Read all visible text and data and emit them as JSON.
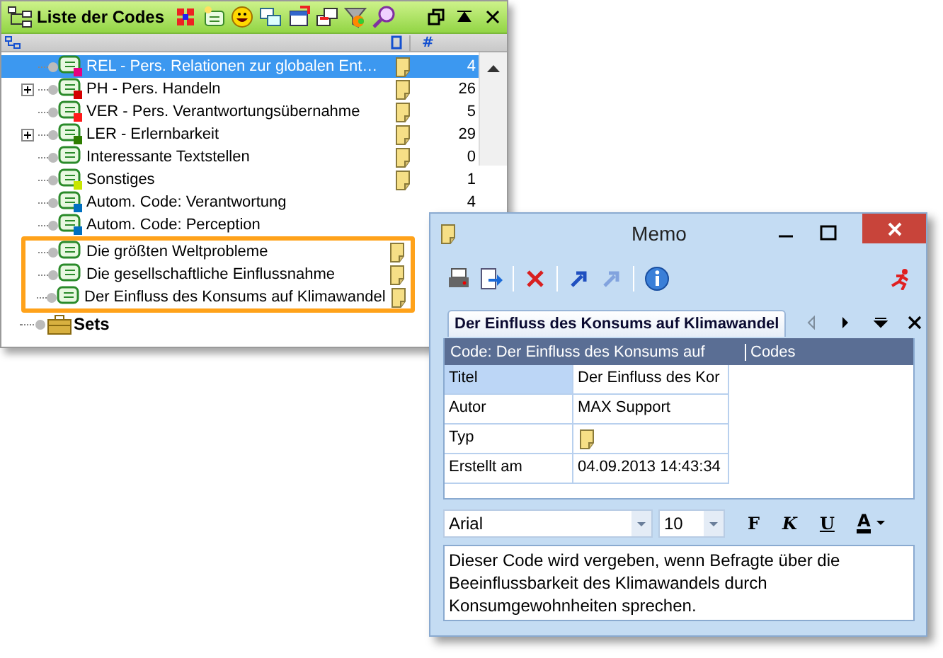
{
  "codes_window": {
    "title": "Liste der Codes",
    "count_header": "#"
  },
  "codes": [
    {
      "label": "REL - Pers. Relationen zur globalen Ent…",
      "selected": true,
      "collapsed": false,
      "color": "#e6007e",
      "memo": true,
      "count": "4"
    },
    {
      "label": "PH - Pers. Handeln",
      "selected": false,
      "collapsed": true,
      "color": "#d40000",
      "memo": true,
      "count": "26"
    },
    {
      "label": "VER - Pers. Verantwortungsübernahme",
      "selected": false,
      "collapsed": false,
      "color": "#ff1a1a",
      "memo": true,
      "count": "5"
    },
    {
      "label": "LER - Erlernbarkeit",
      "selected": false,
      "collapsed": true,
      "color": "#2e7d00",
      "memo": true,
      "count": "29"
    },
    {
      "label": "Interessante Textstellen",
      "selected": false,
      "collapsed": false,
      "memo": true,
      "count": "0"
    },
    {
      "label": "Sonstiges",
      "selected": false,
      "collapsed": false,
      "color": "#c8e600",
      "memo": true,
      "count": "1"
    },
    {
      "label": "Autom. Code: Verantwortung",
      "selected": false,
      "collapsed": false,
      "color": "#0070c0",
      "memo": false,
      "count": "4"
    },
    {
      "label": "Autom. Code: Perception",
      "selected": false,
      "collapsed": false,
      "color": "#0070c0",
      "memo": false
    }
  ],
  "highlighted_codes": [
    {
      "label": "Die größten Weltprobleme",
      "selected": false,
      "collapsed": false,
      "memo": true
    },
    {
      "label": "Die gesellschaftliche Einflussnahme",
      "selected": false,
      "collapsed": false,
      "memo": true
    },
    {
      "label": "Der Einfluss des Konsums auf Klimawandel",
      "selected": false,
      "collapsed": false,
      "memo": true
    }
  ],
  "sets": {
    "label": "Sets"
  },
  "memo_window": {
    "title": "Memo",
    "toolbar": [
      {
        "kind": "print",
        "disabled": false
      },
      {
        "kind": "export",
        "disabled": false
      },
      {
        "kind": "sep"
      },
      {
        "kind": "delete",
        "disabled": false
      },
      {
        "kind": "sep"
      },
      {
        "kind": "link",
        "disabled": false
      },
      {
        "kind": "link",
        "disabled": true
      },
      {
        "kind": "sep"
      },
      {
        "kind": "info",
        "disabled": false
      }
    ],
    "tab": {
      "label": "Der Einfluss des Konsums auf Klimawandel",
      "selected": true
    },
    "tab_controls": [
      {
        "kind": "left",
        "disabled": true
      },
      {
        "kind": "right",
        "disabled": false
      },
      {
        "kind": "menu",
        "disabled": false
      },
      {
        "kind": "close",
        "disabled": false
      }
    ],
    "table": {
      "columns": [
        "Code: Der Einfluss des Konsums auf",
        "Codes"
      ],
      "rows": [
        {
          "label": "Titel",
          "value": "Der Einfluss des Kor",
          "selected": true
        },
        {
          "label": "Autor",
          "value": "MAX Support",
          "selected": false
        },
        {
          "label": "Typ",
          "kind": "memo",
          "selected": false
        },
        {
          "label": "Erstellt am",
          "value": "04.09.2013 14:43:34",
          "selected": false
        }
      ]
    },
    "font": {
      "name": "Arial",
      "size": "10"
    },
    "format_buttons": [
      {
        "kind": "bold",
        "label": "F"
      },
      {
        "kind": "italic",
        "label": "K"
      },
      {
        "kind": "underline",
        "label": "U"
      },
      {
        "kind": "color",
        "label": "A"
      }
    ],
    "text": "Dieser Code wird vergeben, wenn Befragte über die Beeinflussbarkeit des Klimawandels durch Konsumgewohnheiten sprechen."
  }
}
